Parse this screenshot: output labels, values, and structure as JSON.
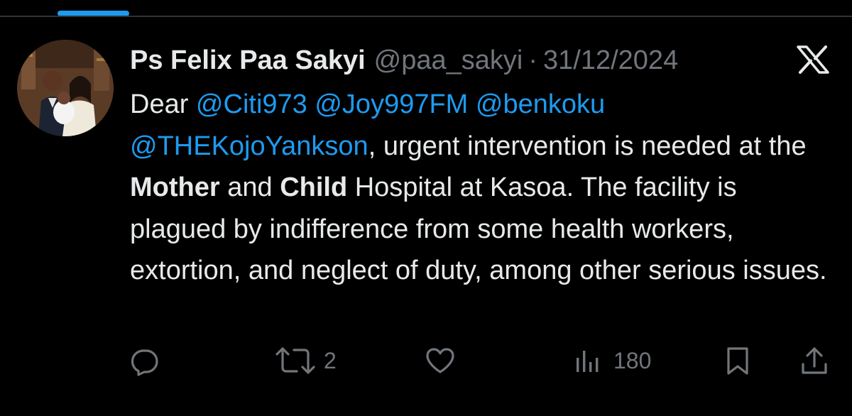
{
  "tweet": {
    "author": {
      "display_name": "Ps Felix Paa Sakyi",
      "handle": "@paa_sakyi",
      "separator": "·",
      "date": "31/12/2024"
    },
    "body": {
      "intro": "Dear ",
      "mentions": [
        "@Citi973",
        "@Joy997FM",
        "@benkoku",
        "@THEKojoYankson"
      ],
      "text_1": ", urgent intervention is needed at the ",
      "bold_1": "Mother",
      "text_2": " and ",
      "bold_2": "Child",
      "text_3": " Hospital at Kasoa. The facility is plagued by indifference from some health workers, extortion, and neglect of duty, among other serious issues."
    },
    "actions": {
      "reply_icon": "reply-icon",
      "retweet_icon": "retweet-icon",
      "retweet_count": "2",
      "like_icon": "heart-icon",
      "views_icon": "views-icon",
      "views_count": "180",
      "bookmark_icon": "bookmark-icon",
      "share_icon": "share-icon"
    }
  },
  "platform_logo": "x-logo-icon",
  "colors": {
    "background": "#000000",
    "text": "#e7e9ea",
    "secondary_text": "#71767b",
    "accent": "#1d9bf0",
    "divider": "#2f3336"
  }
}
